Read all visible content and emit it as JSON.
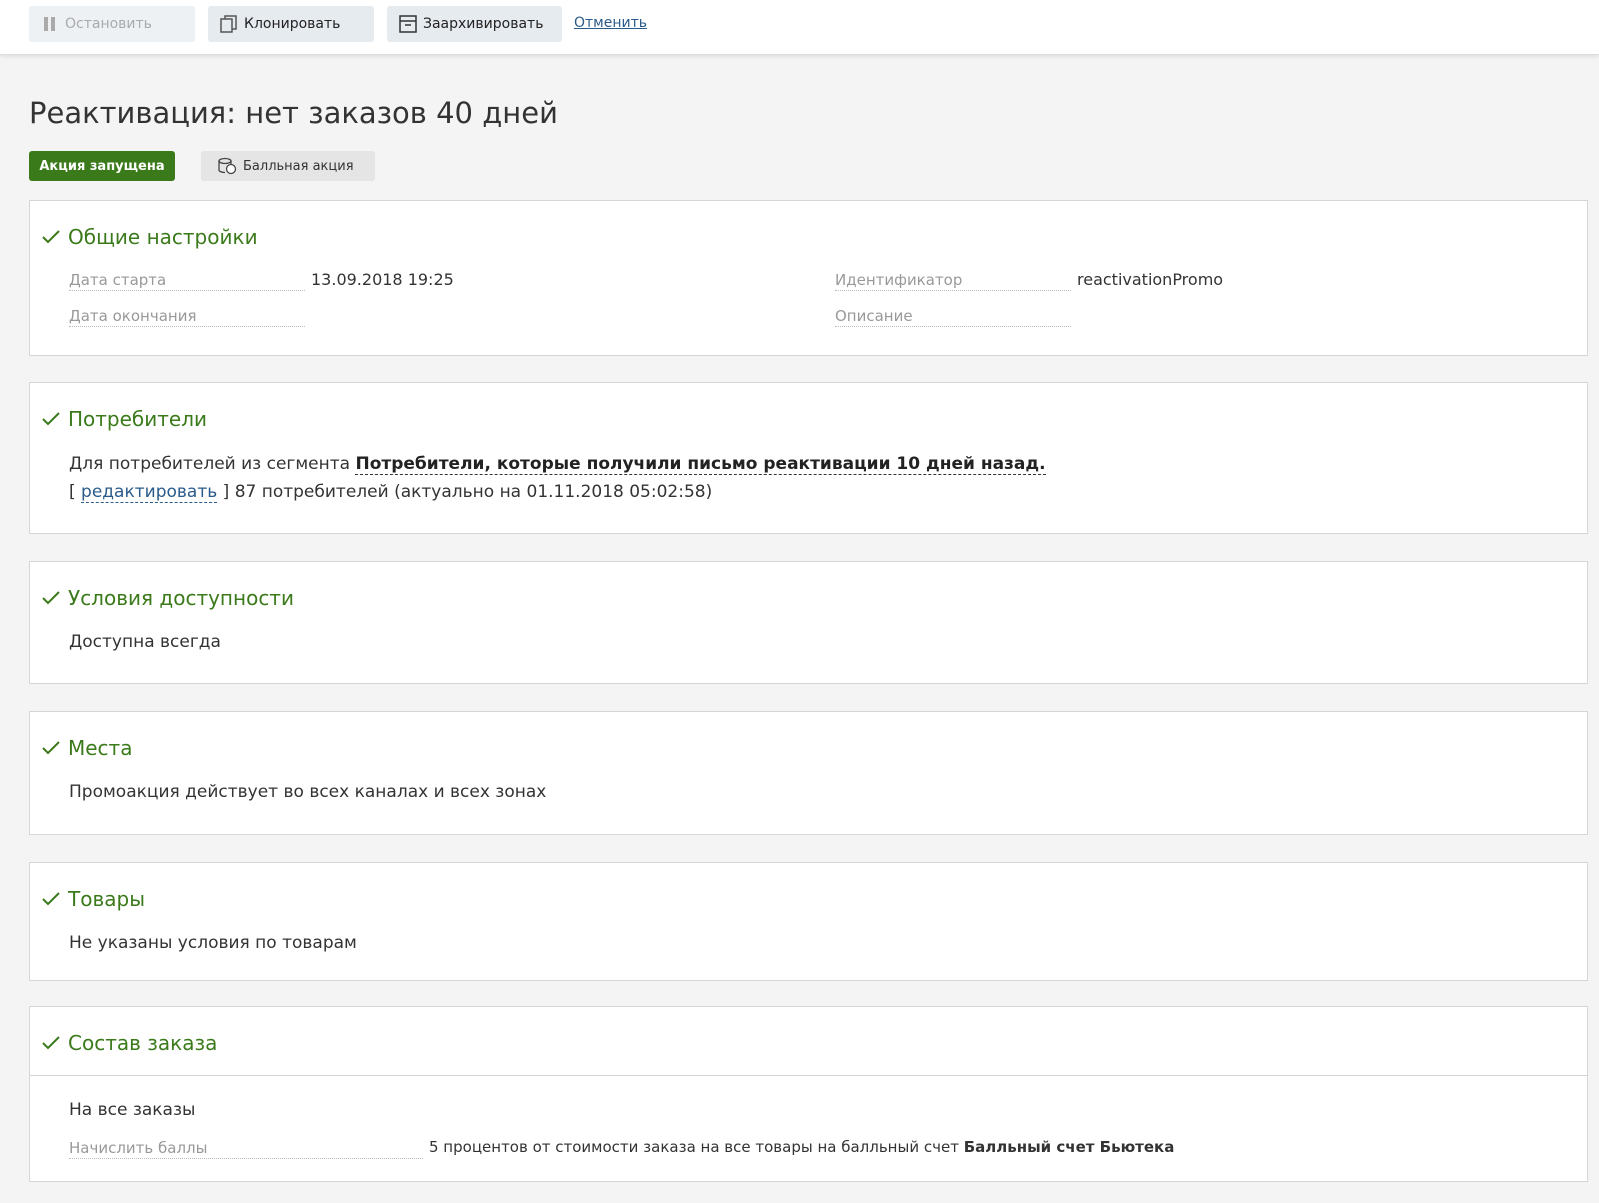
{
  "toolbar": {
    "stop_label": "Остановить",
    "clone_label": "Клонировать",
    "archive_label": "Заархивировать",
    "cancel_label": "Отменить"
  },
  "page": {
    "title": "Реактивация: нет заказов 40 дней",
    "status_badge": "Акция запущена",
    "type_badge": "Балльная акция"
  },
  "general": {
    "title": "Общие настройки",
    "start_label": "Дата старта",
    "start_value": "13.09.2018 19:25",
    "end_label": "Дата окончания",
    "end_value": "",
    "id_label": "Идентификатор",
    "id_value": "reactivationPromo",
    "desc_label": "Описание",
    "desc_value": ""
  },
  "consumers": {
    "title": "Потребители",
    "prefix": "Для потребителей из сегмента ",
    "segment": "Потребители, которые получили письмо реактивации 10 дней назад.",
    "bracket_open": "[ ",
    "edit_link": "редактировать",
    "count_text": " ] 87 потребителей (актуально на 01.11.2018 05:02:58)"
  },
  "availability": {
    "title": "Условия доступности",
    "text": "Доступна всегда"
  },
  "places": {
    "title": "Места",
    "text": "Промоакция действует во всех каналах и всех зонах"
  },
  "products": {
    "title": "Товары",
    "text": "Не указаны условия по товарам"
  },
  "order": {
    "title": "Состав заказа",
    "text": "На все заказы",
    "points_label": "Начислить баллы",
    "points_value": "5 процентов от стоимости заказа на все товары на балльный счет ",
    "points_account": "Балльный счет Бьютека"
  },
  "colors": {
    "accent_green": "#3b7a1a",
    "link_blue": "#2a5b8a"
  }
}
